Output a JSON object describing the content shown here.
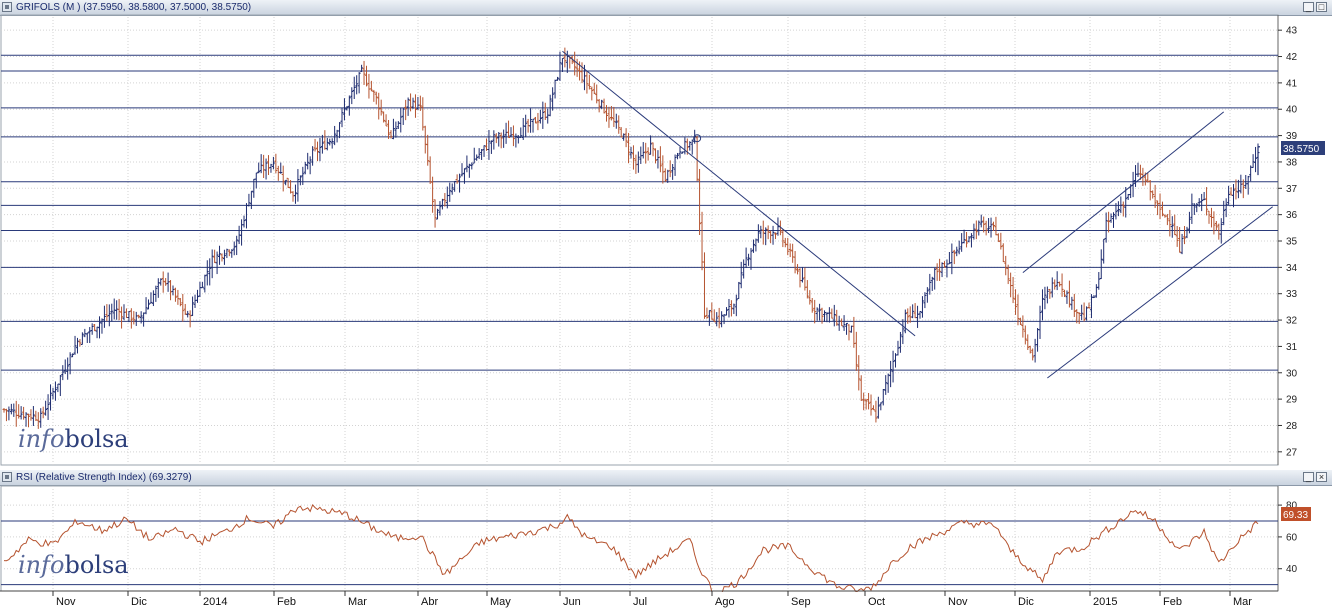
{
  "main_panel": {
    "header": "GRIFOLS (M ) (37.5950, 38.5800, 37.5000, 38.5750)",
    "last_price_label": "38.5750",
    "watermark": {
      "part1": "info",
      "part2": "bolsa"
    }
  },
  "rsi_panel": {
    "header": "RSI (Relative Strength Index) (69.3279)",
    "last_value_label": "69.33",
    "watermark": {
      "part1": "info",
      "part2": "bolsa"
    }
  },
  "window_buttons": {
    "minimize": "_",
    "maximize": "□",
    "close": "×"
  },
  "colors": {
    "up_bar": "#1c2a6e",
    "down_bar": "#b5532f",
    "grid": "#d3d3d3",
    "level_line": "#2a3a7a",
    "rsi_line": "#b5532f",
    "badge_price": "#2d3f7a",
    "badge_rsi": "#c0502a",
    "header_bg": "#c9d3df"
  },
  "chart_data": [
    {
      "type": "ohlc",
      "series_name": "GRIFOLS",
      "ylim": [
        26.5,
        43.5
      ],
      "y_ticks": [
        27,
        28,
        29,
        30,
        31,
        32,
        33,
        34,
        35,
        36,
        37,
        38,
        39,
        40,
        41,
        42,
        43
      ],
      "x_labels": [
        "Nov",
        "Dic",
        "2014",
        "Feb",
        "Mar",
        "Abr",
        "May",
        "Jun",
        "Jul",
        "Ago",
        "Sep",
        "Oct",
        "Nov",
        "Dic",
        "2015",
        "Feb",
        "Mar"
      ],
      "horizontal_levels": [
        42.05,
        41.45,
        40.05,
        38.95,
        37.25,
        36.35,
        35.4,
        34.0,
        31.95,
        30.1
      ],
      "price_path_anchors": [
        [
          0,
          28.6
        ],
        [
          15,
          28.3
        ],
        [
          30,
          31.2
        ],
        [
          45,
          32.4
        ],
        [
          55,
          32.0
        ],
        [
          65,
          33.6
        ],
        [
          75,
          32.1
        ],
        [
          85,
          34.3
        ],
        [
          95,
          34.9
        ],
        [
          103,
          37.6
        ],
        [
          110,
          38.0
        ],
        [
          118,
          36.8
        ],
        [
          126,
          38.3
        ],
        [
          134,
          38.9
        ],
        [
          142,
          40.6
        ],
        [
          146,
          41.4
        ],
        [
          152,
          40.4
        ],
        [
          158,
          38.9
        ],
        [
          165,
          40.3
        ],
        [
          170,
          40.0
        ],
        [
          176,
          35.8
        ],
        [
          182,
          37.0
        ],
        [
          192,
          38.1
        ],
        [
          200,
          38.9
        ],
        [
          210,
          39.1
        ],
        [
          222,
          39.9
        ],
        [
          228,
          42.0
        ],
        [
          233,
          41.6
        ],
        [
          238,
          41.0
        ],
        [
          245,
          40.0
        ],
        [
          252,
          39.1
        ],
        [
          258,
          37.9
        ],
        [
          264,
          38.6
        ],
        [
          270,
          37.4
        ],
        [
          276,
          38.5
        ],
        [
          282,
          38.8
        ],
        [
          283,
          37.5
        ],
        [
          286,
          32.3
        ],
        [
          292,
          32.0
        ],
        [
          298,
          32.6
        ],
        [
          303,
          34.3
        ],
        [
          308,
          35.3
        ],
        [
          316,
          35.4
        ],
        [
          322,
          34.3
        ],
        [
          330,
          32.5
        ],
        [
          338,
          32.1
        ],
        [
          346,
          31.6
        ],
        [
          350,
          29.0
        ],
        [
          356,
          28.4
        ],
        [
          362,
          30.1
        ],
        [
          368,
          32.1
        ],
        [
          374,
          32.3
        ],
        [
          380,
          33.8
        ],
        [
          386,
          34.3
        ],
        [
          392,
          35.0
        ],
        [
          398,
          35.6
        ],
        [
          405,
          35.4
        ],
        [
          410,
          33.6
        ],
        [
          414,
          32.2
        ],
        [
          420,
          30.6
        ],
        [
          424,
          32.7
        ],
        [
          430,
          33.6
        ],
        [
          436,
          32.6
        ],
        [
          441,
          32.1
        ],
        [
          446,
          33.1
        ],
        [
          450,
          35.6
        ],
        [
          458,
          36.6
        ],
        [
          463,
          37.6
        ],
        [
          466,
          37.3
        ],
        [
          472,
          36.1
        ],
        [
          477,
          35.7
        ],
        [
          480,
          34.6
        ],
        [
          485,
          36.3
        ],
        [
          490,
          36.5
        ],
        [
          496,
          35.3
        ],
        [
          500,
          36.9
        ],
        [
          506,
          37.0
        ],
        [
          512,
          38.5
        ]
      ]
    },
    {
      "type": "line",
      "series_name": "RSI",
      "ylim": [
        26,
        92
      ],
      "y_ticks": [
        40,
        60,
        80
      ],
      "horizontal_levels": [
        70,
        30
      ],
      "rsi_path_anchors": [
        [
          0,
          44
        ],
        [
          10,
          58
        ],
        [
          20,
          55
        ],
        [
          30,
          70
        ],
        [
          40,
          64
        ],
        [
          50,
          71
        ],
        [
          60,
          58
        ],
        [
          70,
          65
        ],
        [
          80,
          57
        ],
        [
          90,
          63
        ],
        [
          100,
          72
        ],
        [
          110,
          66
        ],
        [
          120,
          79
        ],
        [
          130,
          77
        ],
        [
          140,
          74
        ],
        [
          150,
          66
        ],
        [
          160,
          59
        ],
        [
          170,
          61
        ],
        [
          180,
          36
        ],
        [
          186,
          45
        ],
        [
          195,
          57
        ],
        [
          205,
          60
        ],
        [
          215,
          63
        ],
        [
          225,
          67
        ],
        [
          230,
          72
        ],
        [
          238,
          59
        ],
        [
          248,
          54
        ],
        [
          258,
          36
        ],
        [
          270,
          49
        ],
        [
          280,
          58
        ],
        [
          283,
          44
        ],
        [
          290,
          24
        ],
        [
          300,
          32
        ],
        [
          310,
          52
        ],
        [
          320,
          54
        ],
        [
          330,
          40
        ],
        [
          340,
          29
        ],
        [
          350,
          26
        ],
        [
          356,
          30
        ],
        [
          362,
          43
        ],
        [
          370,
          54
        ],
        [
          380,
          61
        ],
        [
          392,
          69
        ],
        [
          405,
          67
        ],
        [
          410,
          53
        ],
        [
          418,
          41
        ],
        [
          424,
          32
        ],
        [
          430,
          51
        ],
        [
          440,
          53
        ],
        [
          450,
          64
        ],
        [
          462,
          77
        ],
        [
          470,
          70
        ],
        [
          480,
          51
        ],
        [
          490,
          63
        ],
        [
          496,
          43
        ],
        [
          504,
          58
        ],
        [
          512,
          69
        ]
      ]
    }
  ]
}
